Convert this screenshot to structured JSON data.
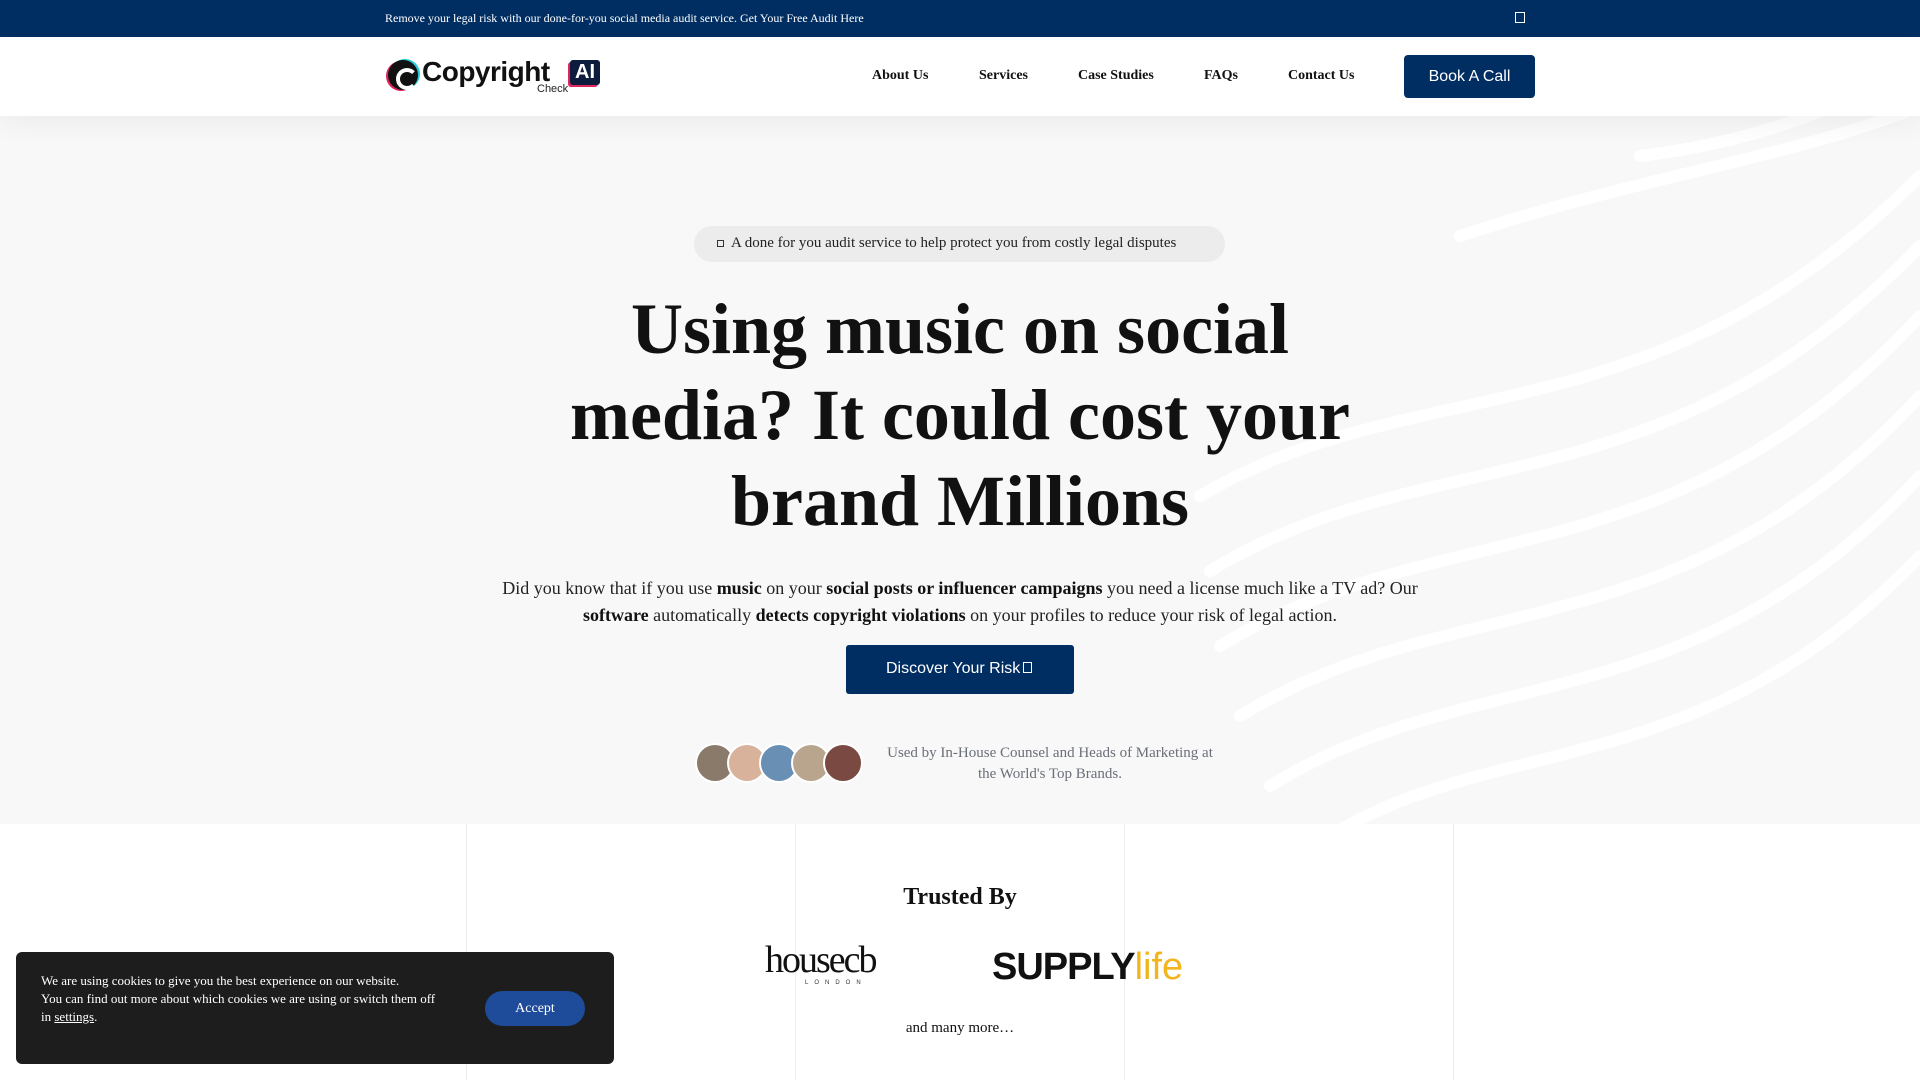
{
  "announcement": {
    "text": "Remove your legal risk with our done-for-you social media audit service. Get Your Free Audit Here",
    "close_icon": "close-icon"
  },
  "header": {
    "logo": {
      "word": "Copyright",
      "badge": "AI",
      "tag": "Check"
    },
    "nav": [
      {
        "label": "About Us"
      },
      {
        "label": "Services"
      },
      {
        "label": "Case Studies"
      },
      {
        "label": "FAQs"
      },
      {
        "label": "Contact Us"
      }
    ],
    "cta": "Book A Call",
    "brand_color": "#002e63"
  },
  "hero": {
    "pill": "A done for you audit service to help protect you from costly legal disputes",
    "headline": "Using music on social media? It could cost your brand Millions",
    "sub_parts": [
      "Did you know that if you use ",
      "music",
      " on your ",
      "social posts or influencer campaigns",
      " you need a license much like a TV ad? Our ",
      "software",
      " automatically ",
      "detects copyright violations",
      " on your profiles to reduce your risk of legal action."
    ],
    "cta": "Discover Your Risk",
    "used_by": "Used by In-House Counsel and Heads of Marketing at the World's Top Brands.",
    "avatar_colors": [
      "#8a7a6a",
      "#d8b29a",
      "#6a8fb5",
      "#b9a58e",
      "#7a4a42"
    ]
  },
  "trusted": {
    "title": "Trusted By",
    "logos": [
      {
        "name": "housecb",
        "sub": "LONDON"
      },
      {
        "name_a": "SUPPLY",
        "name_b": "life"
      }
    ],
    "more": "and many more…"
  },
  "cookie": {
    "line1": "We are using cookies to give you the best experience on our website.",
    "line2": "You can find out more about which cookies we are using or switch them off in ",
    "link": "settings",
    "end": ".",
    "accept": "Accept"
  }
}
